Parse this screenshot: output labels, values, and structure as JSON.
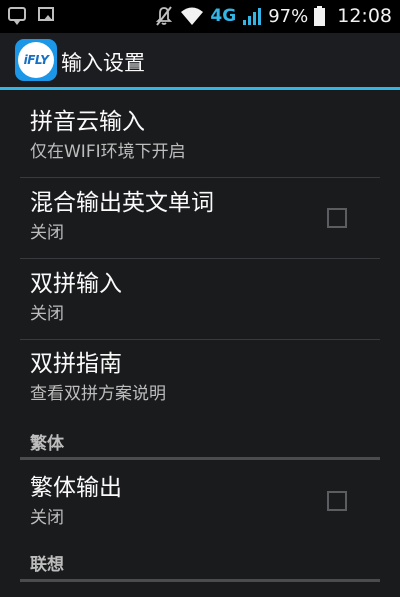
{
  "status_bar": {
    "network": "4G",
    "battery": "97%",
    "time": "12:08",
    "icons": [
      "message-icon",
      "image-icon",
      "mute-icon",
      "wifi-icon",
      "signal-icon",
      "battery-icon"
    ]
  },
  "app_bar": {
    "icon_text": "iFLY",
    "title": "输入设置"
  },
  "items": [
    {
      "title": "拼音云输入",
      "summary": "仅在WIFI环境下开启"
    },
    {
      "title": "混合输出英文单词",
      "summary": "关闭",
      "checked": false
    },
    {
      "title": "双拼输入",
      "summary": "关闭"
    },
    {
      "title": "双拼指南",
      "summary": "查看双拼方案说明"
    },
    {
      "title": "繁体输出",
      "summary": "关闭",
      "checked": false
    }
  ],
  "sections": [
    {
      "label": "繁体"
    },
    {
      "label": "联想"
    }
  ],
  "colors": {
    "accent": "#33b5e5",
    "background": "#1a1b1d"
  }
}
